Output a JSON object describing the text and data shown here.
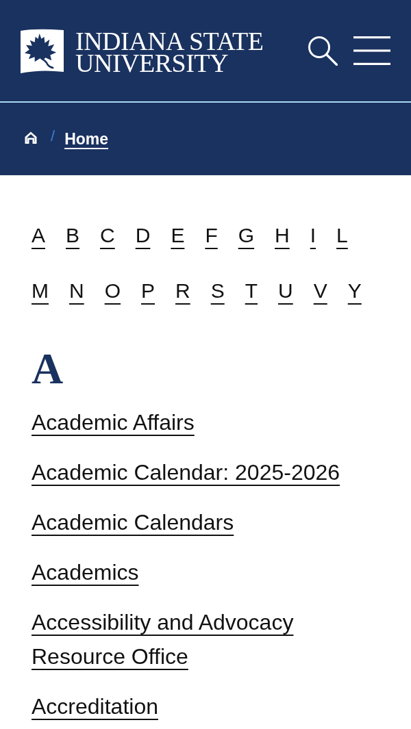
{
  "header": {
    "logo": {
      "lines": [
        "INDIANA STATE",
        "UNIVERSITY"
      ]
    }
  },
  "breadcrumb": {
    "separator": "/",
    "items": [
      {
        "label": "Home"
      }
    ]
  },
  "letters": [
    "A",
    "B",
    "C",
    "D",
    "E",
    "F",
    "G",
    "H",
    "I",
    "L",
    "M",
    "N",
    "O",
    "P",
    "R",
    "S",
    "T",
    "U",
    "V",
    "Y"
  ],
  "sections": [
    {
      "heading": "A",
      "links": [
        "Academic Affairs",
        "Academic Calendar: 2025-2026",
        "Academic Calendars",
        "Academics",
        "Accessibility and Advocacy Resource Office",
        "Accreditation"
      ]
    }
  ]
}
